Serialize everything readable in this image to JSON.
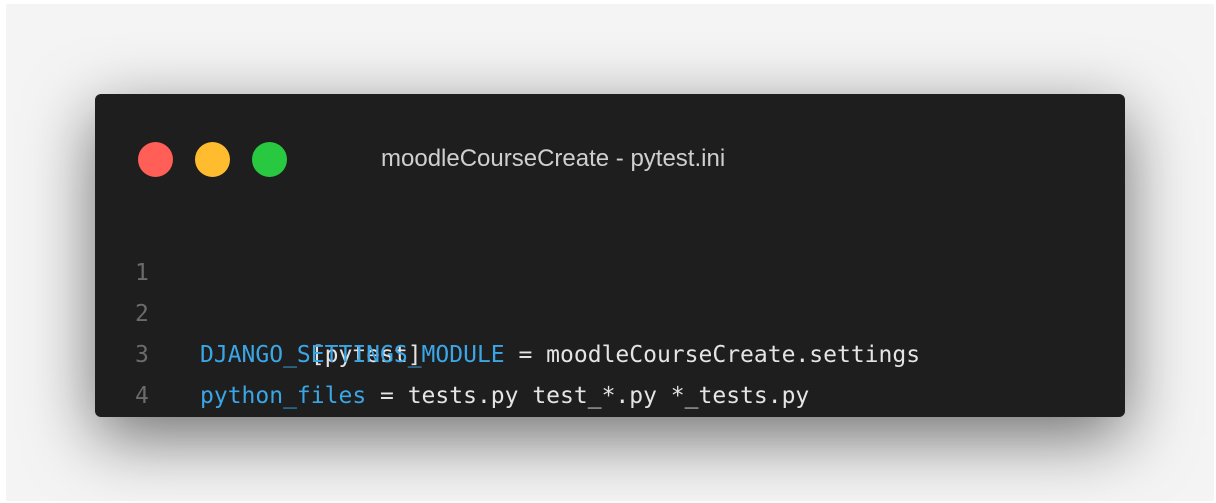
{
  "window": {
    "title": "moodleCourseCreate - pytest.ini",
    "traffic_lights": [
      {
        "name": "close",
        "color": "#ff5f57"
      },
      {
        "name": "minimize",
        "color": "#febc2e"
      },
      {
        "name": "zoom",
        "color": "#28c840"
      }
    ]
  },
  "colors": {
    "key": "#3ba6e6",
    "text": "#e4e4e4",
    "line_number": "#6b6b6b",
    "background": "#1e1e1e"
  },
  "editor": {
    "lines": [
      {
        "number": "1",
        "tokens": [
          {
            "text": "[pytest]",
            "kind": "plain"
          }
        ]
      },
      {
        "number": "2",
        "tokens": [
          {
            "text": "DJANGO_SETTINGS_MODULE",
            "kind": "key"
          },
          {
            "text": " = moodleCourseCreate.settings",
            "kind": "plain"
          }
        ]
      },
      {
        "number": "3",
        "tokens": [
          {
            "text": "python_files",
            "kind": "key"
          },
          {
            "text": " = tests.py test_*.py *_tests.py",
            "kind": "plain"
          }
        ]
      },
      {
        "number": "4",
        "tokens": []
      }
    ]
  }
}
